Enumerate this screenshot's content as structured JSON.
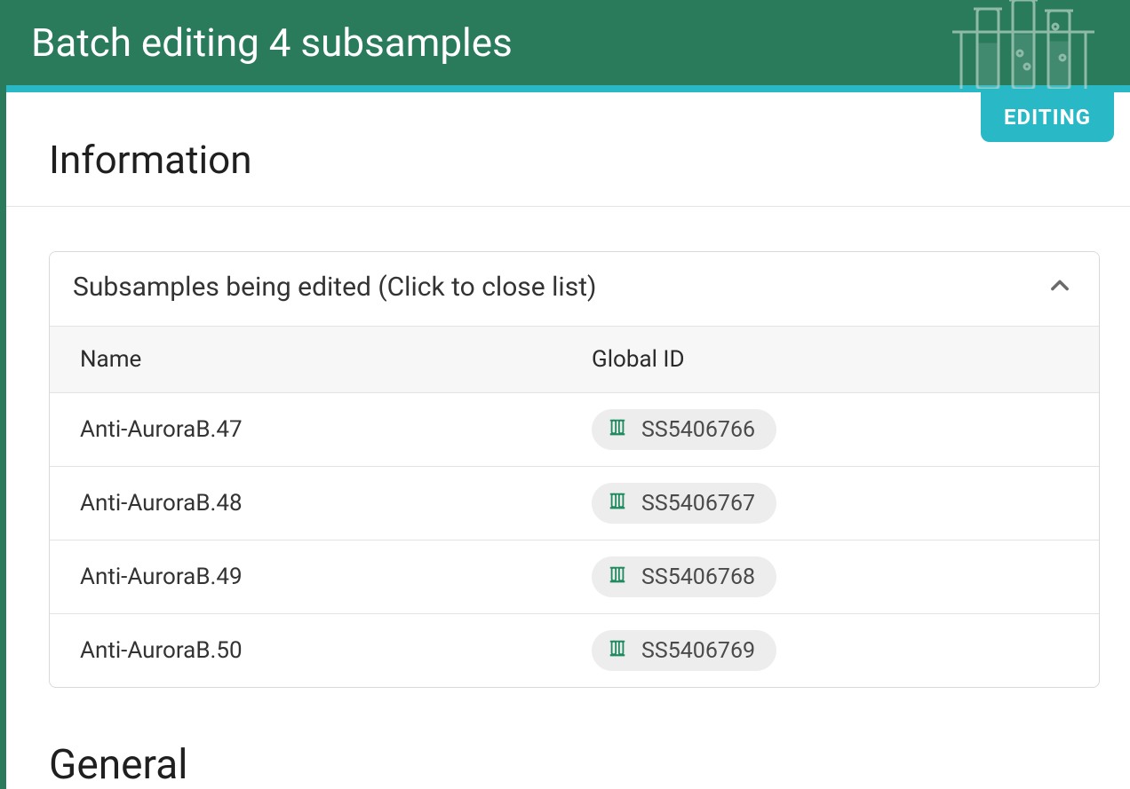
{
  "header": {
    "title": "Batch editing 4 subsamples"
  },
  "badge": {
    "label": "EDITING"
  },
  "sections": {
    "information_heading": "Information",
    "general_heading": "General"
  },
  "panel": {
    "header_text": "Subsamples being edited (Click to close list)",
    "columns": {
      "name": "Name",
      "global_id": "Global ID"
    },
    "rows": [
      {
        "name": "Anti-AuroraB.47",
        "global_id": "SS5406766"
      },
      {
        "name": "Anti-AuroraB.48",
        "global_id": "SS5406767"
      },
      {
        "name": "Anti-AuroraB.49",
        "global_id": "SS5406768"
      },
      {
        "name": "Anti-AuroraB.50",
        "global_id": "SS5406769"
      }
    ]
  },
  "colors": {
    "primary_green": "#2a7a5c",
    "accent_teal": "#28b8c6"
  }
}
